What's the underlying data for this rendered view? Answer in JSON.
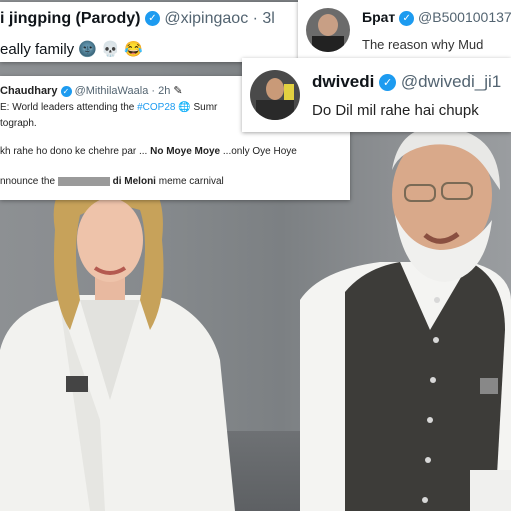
{
  "tweet_a": {
    "name": "i jingping (Parody)",
    "handle": "@xipingaoc · 3l",
    "text": "eally family",
    "emojis": [
      "🌚",
      "💀",
      "😂"
    ]
  },
  "tweet_b": {
    "name": "Брат",
    "handle": "@B500100137",
    "text": "The reason why Mud"
  },
  "tweet_c": {
    "name": "Chaudhary",
    "handle": "@MithilaWaala · 2h",
    "line1_prefix": "E: World leaders attending the",
    "line1_hashtag": "#COP28",
    "line1_suffix": "Sumr",
    "line2": "tograph.",
    "line3_prefix": "kh rahe ho dono ke chehre par ...",
    "line3_bold": "No Moye Moye",
    "line3_suffix": "...only Oye Hoye",
    "line4_prefix": "nnounce the",
    "line4_bold": "di Meloni",
    "line4_suffix": "meme carnival"
  },
  "tweet_d": {
    "name": "dwivedi",
    "handle": "@dwivedi_ji1",
    "text": "Do Dil mil rahe hai chupk"
  },
  "colors": {
    "verified": "#1d9bf0",
    "handle": "#536471",
    "white_suit": "#f4f4f2",
    "vest": "#3a3a38"
  }
}
